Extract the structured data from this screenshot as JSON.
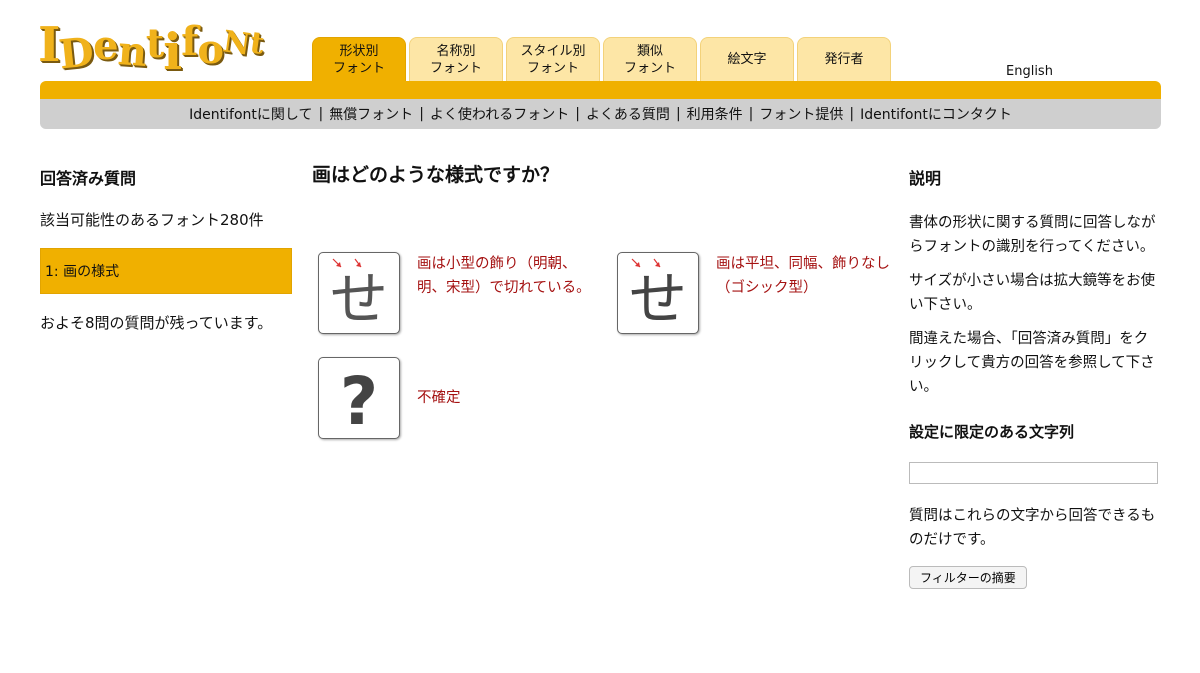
{
  "logo": {
    "letters": [
      "I",
      "D",
      "e",
      "n",
      "t",
      "i",
      "f",
      "o",
      "N",
      "t"
    ]
  },
  "tabs": [
    {
      "label": "形状別\nフォント",
      "active": true
    },
    {
      "label": "名称別\nフォント"
    },
    {
      "label": "スタイル別\nフォント"
    },
    {
      "label": "類似\nフォント"
    },
    {
      "label": "絵文字"
    },
    {
      "label": "発行者"
    }
  ],
  "language_link": "English",
  "subnav": [
    "Identifontに関して",
    "無償フォント",
    "よく使われるフォント",
    "よくある質問",
    "利用条件",
    "フォント提供",
    "Identifontにコンタクト"
  ],
  "subnav_separator": "|",
  "left": {
    "heading": "回答済み質問",
    "count_text": "該当可能性のあるフォント280件",
    "answered_item": "1: 画の様式",
    "remaining_text": "およそ8問の質問が残っています。"
  },
  "question": {
    "title": "画はどのような様式ですか？",
    "options": [
      {
        "glyph": "せ",
        "label": "画は小型の飾り（明朝、明、宋型）で切れている。",
        "icon": "serif-se-icon"
      },
      {
        "glyph": "せ",
        "label": "画は平坦、同幅、飾りなし（ゴシック型）",
        "icon": "sans-se-icon"
      },
      {
        "glyph": "?",
        "label": "不確定",
        "icon": "question-mark-icon"
      }
    ]
  },
  "explanation": {
    "heading": "説明",
    "paragraphs": [
      "書体の形状に関する質問に回答しながらフォントの識別を行ってください。",
      "サイズが小さい場合は拡大鏡等をお使い下さい。",
      "間違えた場合、「回答済み質問」をクリックして貴方の回答を参照して下さい。"
    ],
    "filter_heading": "設定に限定のある文字列",
    "filter_value": "",
    "filter_note": "質問はこれらの文字から回答できるものだけです。",
    "filter_button": "フィルターの摘要"
  },
  "colors": {
    "accent": "#f0b000",
    "tab_inactive": "#fde6a6",
    "subnav_bg": "#cfcfcf",
    "option_text": "#a51212"
  }
}
